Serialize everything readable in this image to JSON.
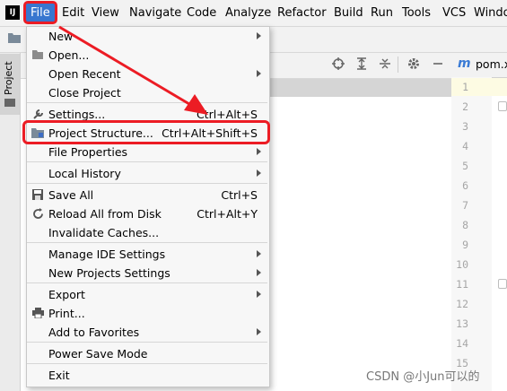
{
  "menubar": {
    "logo": "IJ",
    "items": [
      "File",
      "Edit",
      "View",
      "Navigate",
      "Code",
      "Analyze",
      "Refactor",
      "Build",
      "Run",
      "Tools",
      "VCS",
      "Windo"
    ]
  },
  "left_strip": {
    "label": "Project"
  },
  "editor": {
    "tab_icon": "m",
    "tab_label": "pom.x",
    "line_numbers": [
      "1",
      "2",
      "3",
      "4",
      "5",
      "6",
      "7",
      "8",
      "9",
      "10",
      "11",
      "12",
      "13",
      "14",
      "15"
    ]
  },
  "file_menu": {
    "new": "New",
    "open": "Open...",
    "open_recent": "Open Recent",
    "close_project": "Close Project",
    "settings": "Settings...",
    "settings_shortcut": "Ctrl+Alt+S",
    "project_structure": "Project Structure...",
    "project_structure_shortcut": "Ctrl+Alt+Shift+S",
    "file_properties": "File Properties",
    "local_history": "Local History",
    "save_all": "Save All",
    "save_all_shortcut": "Ctrl+S",
    "reload_all": "Reload All from Disk",
    "reload_all_shortcut": "Ctrl+Alt+Y",
    "invalidate_caches": "Invalidate Caches...",
    "manage_ide_settings": "Manage IDE Settings",
    "new_projects_settings": "New Projects Settings",
    "export": "Export",
    "print": "Print...",
    "add_to_favorites": "Add to Favorites",
    "power_save_mode": "Power Save Mode",
    "exit": "Exit"
  },
  "watermark": "CSDN @小Jun可以的",
  "colors": {
    "menu_active": "#3876cf",
    "annotation_red": "#ec1c24"
  }
}
